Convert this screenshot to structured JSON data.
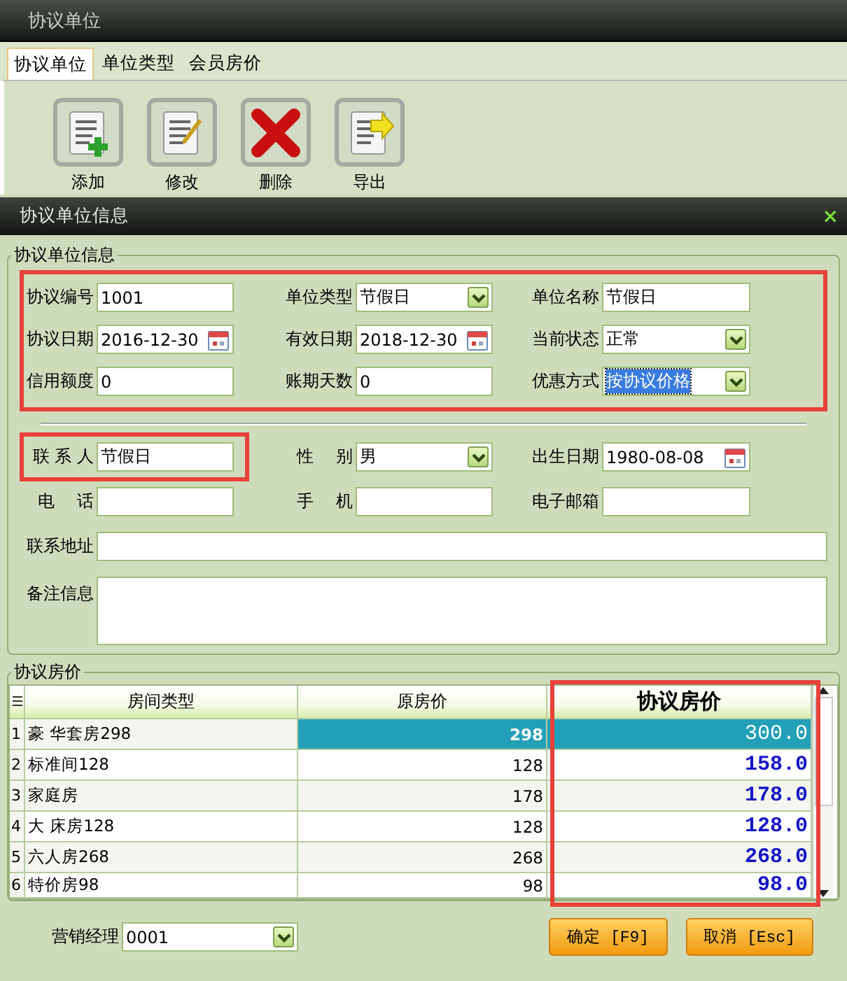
{
  "window": {
    "title": "协议单位"
  },
  "tabs": [
    {
      "label": "协议单位",
      "selected": true
    },
    {
      "label": "单位类型",
      "selected": false
    },
    {
      "label": "会员房价",
      "selected": false
    }
  ],
  "toolbar": [
    {
      "label": "添加",
      "kind": "add"
    },
    {
      "label": "修改",
      "kind": "edit"
    },
    {
      "label": "删除",
      "kind": "delete"
    },
    {
      "label": "导出",
      "kind": "export"
    }
  ],
  "dialog": {
    "title": "协议单位信息",
    "close": "×"
  },
  "info_group": {
    "title": "协议单位信息",
    "highlighted": true,
    "rows": [
      {
        "fields": [
          {
            "label": "协议编号",
            "kind": "text",
            "value": "1001"
          },
          {
            "label": "单位类型",
            "kind": "select",
            "value": "节假日"
          },
          {
            "label": "单位名称",
            "kind": "text",
            "value": "节假日"
          }
        ]
      },
      {
        "fields": [
          {
            "label": "协议日期",
            "kind": "date",
            "value": "2016-12-30"
          },
          {
            "label": "有效日期",
            "kind": "date",
            "value": "2018-12-30"
          },
          {
            "label": "当前状态",
            "kind": "select",
            "value": "正常"
          }
        ]
      },
      {
        "fields": [
          {
            "label": "信用额度",
            "kind": "text",
            "value": "0"
          },
          {
            "label": "账期天数",
            "kind": "text",
            "value": "0"
          },
          {
            "label": "优惠方式",
            "kind": "select",
            "value": "按协议价格",
            "focused": true
          }
        ]
      }
    ],
    "contact_rows": [
      {
        "fields": [
          {
            "label": "联 系 人",
            "kind": "text",
            "value": "节假日",
            "highlighted": true
          },
          {
            "label": "性　 别",
            "kind": "select",
            "value": "男"
          },
          {
            "label": "出生日期",
            "kind": "date",
            "value": "1980-08-08"
          }
        ]
      },
      {
        "fields": [
          {
            "label": "电　 话",
            "kind": "text"
          },
          {
            "label": "手　 机",
            "kind": "text"
          },
          {
            "label": "电子邮箱",
            "kind": "text"
          }
        ]
      }
    ],
    "address": {
      "label": "联系地址"
    },
    "notes": {
      "label": "备注信息"
    }
  },
  "price_group": {
    "title": "协议房价",
    "highlight_last_column": true,
    "columns": [
      "房间类型",
      "原房价",
      "协议房价"
    ],
    "rows": [
      {
        "no": "1",
        "room_type": "豪  华套房298",
        "original": "298",
        "agreed": "300.0",
        "selected": true
      },
      {
        "no": "2",
        "room_type": "标准间128",
        "original": "128",
        "agreed": "158.0",
        "selected": false
      },
      {
        "no": "3",
        "room_type": "家庭房",
        "original": "178",
        "agreed": "178.0",
        "selected": false
      },
      {
        "no": "4",
        "room_type": "大  床房128",
        "original": "128",
        "agreed": "128.0",
        "selected": false
      },
      {
        "no": "5",
        "room_type": "六人房268",
        "original": "268",
        "agreed": "268.0",
        "selected": false
      },
      {
        "no": "6",
        "room_type": "特价房98",
        "original": "98",
        "agreed": "98.0",
        "selected": false
      }
    ]
  },
  "footer": {
    "manager_label": "营销经理",
    "manager_value": "0001",
    "buttons": [
      "确定 [F9]",
      "取消 [Esc]"
    ]
  }
}
